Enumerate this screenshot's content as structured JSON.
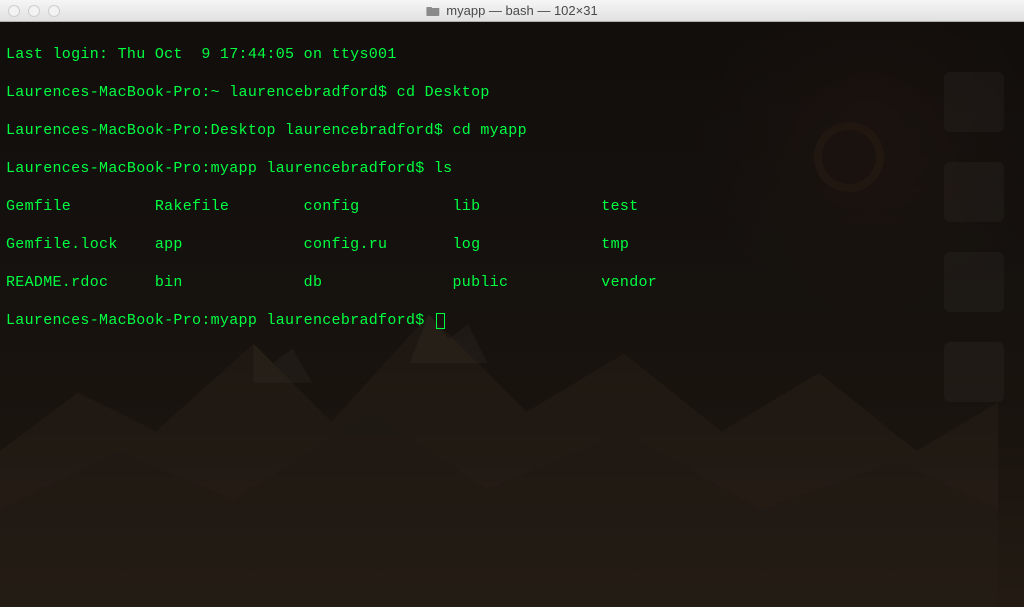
{
  "window": {
    "title": "myapp — bash — 102×31"
  },
  "terminal": {
    "lines": [
      "Last login: Thu Oct  9 17:44:05 on ttys001",
      "Laurences-MacBook-Pro:~ laurencebradford$ cd Desktop",
      "Laurences-MacBook-Pro:Desktop laurencebradford$ cd myapp",
      "Laurences-MacBook-Pro:myapp laurencebradford$ ls",
      "Gemfile         Rakefile        config          lib             test",
      "Gemfile.lock    app             config.ru       log             tmp",
      "README.rdoc     bin             db              public          vendor"
    ],
    "prompt": "Laurences-MacBook-Pro:myapp laurencebradford$ "
  }
}
